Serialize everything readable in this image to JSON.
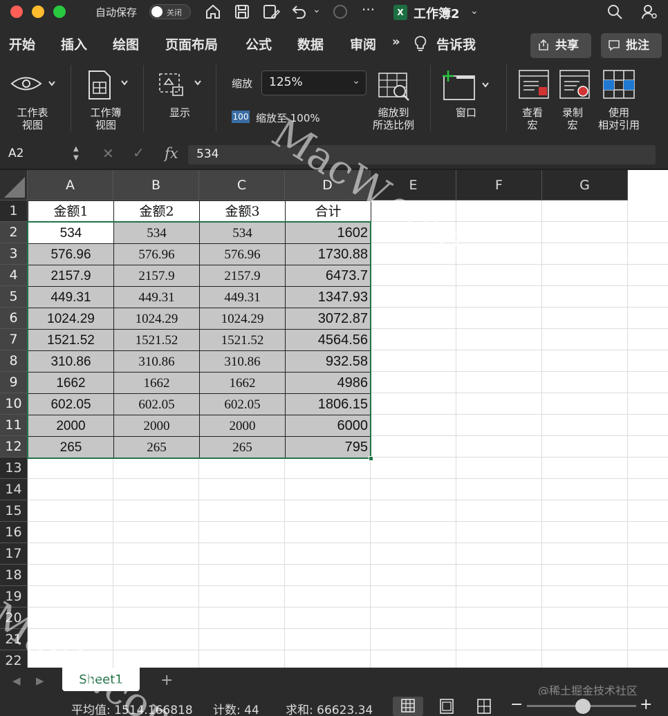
{
  "titlebar": {
    "autosave_label": "自动保存",
    "autosave_toggle": "关闭",
    "doc_title": "工作簿2",
    "app_icon_letter": "X"
  },
  "menu": {
    "tabs": [
      "开始",
      "插入",
      "绘图",
      "页面布局",
      "公式",
      "数据",
      "审阅",
      "告诉我"
    ],
    "share_label": "共享",
    "comment_label": "批注"
  },
  "ribbon": {
    "sheet_view": "工作表\n视图",
    "workbook_view": "工作簿\n视图",
    "show": "显示",
    "zoom_label": "缩放",
    "zoom_value": "125%",
    "zoom100_icon": "100",
    "zoom100_label": "缩放至 100%",
    "zoom_selection": "缩放到\n所选比例",
    "window": "窗口",
    "view_macros": "查看\n宏",
    "record_macro": "录制\n宏",
    "relative_refs": "使用\n相对引用"
  },
  "formula_bar": {
    "name_box": "A2",
    "fx": "fx",
    "formula": "534"
  },
  "sheet": {
    "columns": [
      "A",
      "B",
      "C",
      "D",
      "E",
      "F",
      "G"
    ],
    "rows": [
      "1",
      "2",
      "3",
      "4",
      "5",
      "6",
      "7",
      "8",
      "9",
      "10",
      "11",
      "12",
      "13",
      "14",
      "15",
      "16",
      "17",
      "18",
      "19",
      "20",
      "21",
      "22"
    ],
    "headers": [
      "金额1",
      "金额2",
      "金额3",
      "合计"
    ],
    "data": [
      [
        "534",
        "534",
        "534",
        "1602"
      ],
      [
        "576.96",
        "576.96",
        "576.96",
        "1730.88"
      ],
      [
        "2157.9",
        "2157.9",
        "2157.9",
        "6473.7"
      ],
      [
        "449.31",
        "449.31",
        "449.31",
        "1347.93"
      ],
      [
        "1024.29",
        "1024.29",
        "1024.29",
        "3072.87"
      ],
      [
        "1521.52",
        "1521.52",
        "1521.52",
        "4564.56"
      ],
      [
        "310.86",
        "310.86",
        "310.86",
        "932.58"
      ],
      [
        "1662",
        "1662",
        "1662",
        "4986"
      ],
      [
        "602.05",
        "602.05",
        "602.05",
        "1806.15"
      ],
      [
        "2000",
        "2000",
        "2000",
        "6000"
      ],
      [
        "265",
        "265",
        "265",
        "795"
      ]
    ]
  },
  "sheet_tabs": {
    "active": "Sheet1",
    "add": "+",
    "community": "@稀土掘金技术社区"
  },
  "status": {
    "average": "平均值: 1514.166818",
    "count": "计数: 44",
    "sum": "求和: 66623.34",
    "zoom_minus": "−",
    "zoom_plus": "+"
  },
  "watermarks": [
    "MacW.com",
    "MacW.com"
  ]
}
